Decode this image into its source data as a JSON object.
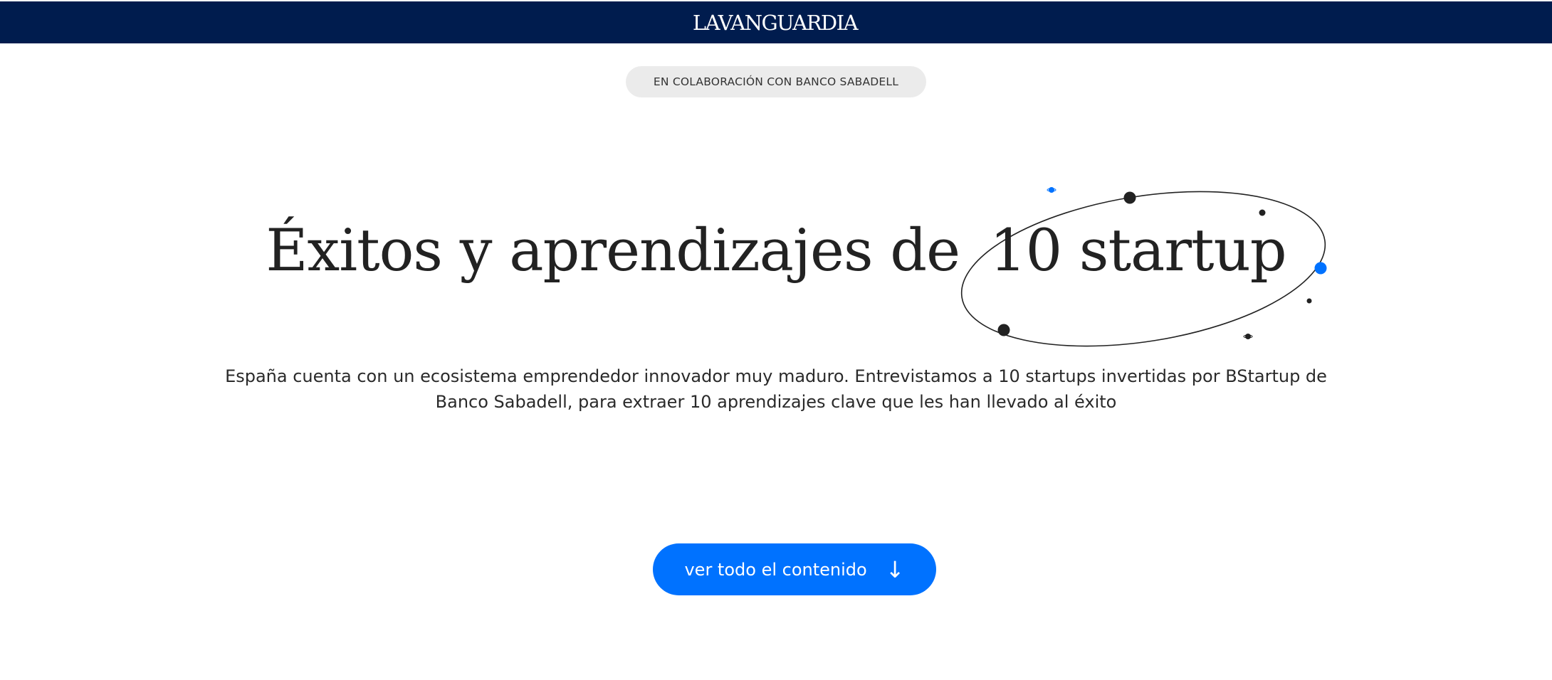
{
  "header": {
    "logo_text": "LAVANGUARDIA",
    "background_color": "#001c4e"
  },
  "badge": {
    "label": "EN COLABORACIÓN CON BANCO SABADELL"
  },
  "hero": {
    "title_main": "Éxitos y aprendizajes de",
    "title_highlight": "10 startup",
    "description": "España cuenta con un ecosistema emprendedor innovador muy maduro. Entrevistamos a 10 startups invertidas por BStartup de Banco Sabadell, para extraer 10 aprendizajes clave que les han llevado al éxito"
  },
  "cta": {
    "label": "ver todo el contenido",
    "icon": "arrow-down-icon",
    "color": "#0072ff"
  },
  "colors": {
    "accent_blue": "#0072ff",
    "text_dark": "#222222",
    "badge_bg": "#ebebeb"
  }
}
